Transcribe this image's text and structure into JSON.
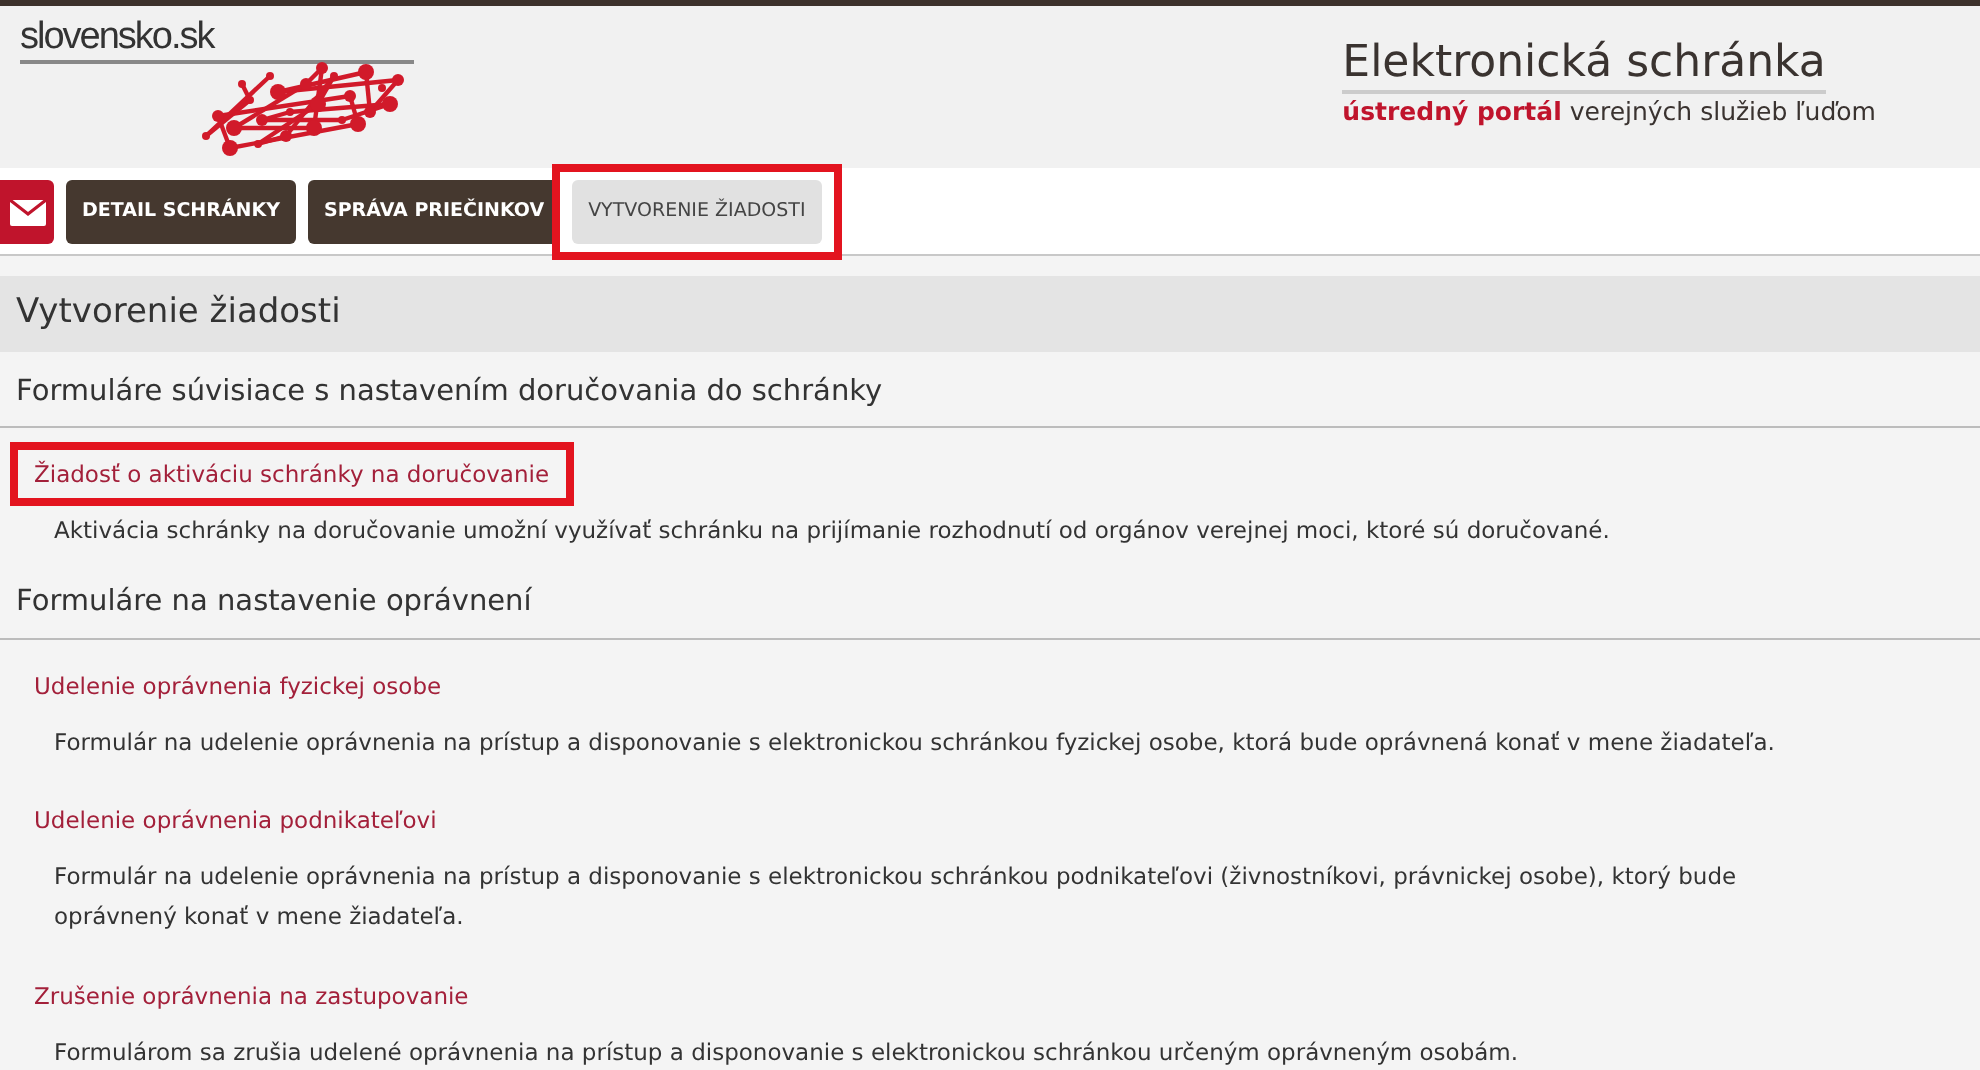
{
  "header": {
    "logo_text": "slovensko.sk",
    "title": "Elektronická schránka",
    "subtitle_accent": "ústredný portál",
    "subtitle_rest": "verejných služieb ľuďom"
  },
  "tabs": [
    {
      "kind": "icon",
      "selected": false,
      "highlighted": false
    },
    {
      "kind": "text",
      "label": "DETAIL SCHRÁNKY",
      "selected": false,
      "highlighted": false
    },
    {
      "kind": "text",
      "label": "SPRÁVA PRIEČINKOV",
      "selected": false,
      "highlighted": false
    },
    {
      "kind": "text",
      "label": "VYTVORENIE ŽIADOSTI",
      "selected": true,
      "highlighted": true
    }
  ],
  "page_title": "Vytvorenie žiadosti",
  "sections": [
    {
      "heading": "Formuláre súvisiace s nastavením doručovania do schránky",
      "forms": [
        {
          "link": "Žiadosť o aktiváciu schránky na doručovanie",
          "highlighted": true,
          "description": "Aktivácia schránky na doručovanie umožní využívať schránku na prijímanie rozhodnutí od orgánov verejnej moci, ktoré sú doručované."
        }
      ]
    },
    {
      "heading": "Formuláre na nastavenie oprávnení",
      "forms": [
        {
          "link": "Udelenie oprávnenia fyzickej osobe",
          "highlighted": false,
          "description": "Formulár na udelenie oprávnenia na prístup a disponovanie s elektronickou schránkou fyzickej osobe, ktorá bude oprávnená konať v mene žiadateľa."
        },
        {
          "link": "Udelenie oprávnenia podnikateľovi",
          "highlighted": false,
          "description": "Formulár na udelenie oprávnenia na prístup a disponovanie s elektronickou schránkou podnikateľovi (živnostníkovi, právnickej osobe), ktorý bude oprávnený konať v mene žiadateľa."
        },
        {
          "link": "Zrušenie oprávnenia na zastupovanie",
          "highlighted": false,
          "description": "Formulárom sa zrušia udelené oprávnenia na prístup a disponovanie s elektronickou schránkou určeným oprávneným osobám."
        }
      ]
    }
  ]
}
